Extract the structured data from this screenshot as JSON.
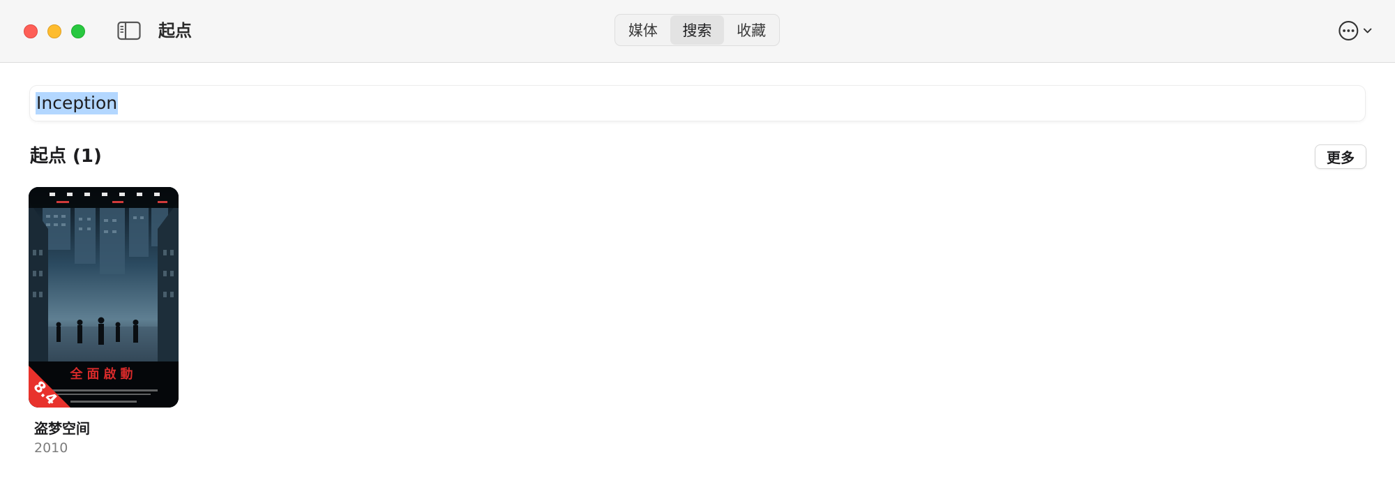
{
  "window": {
    "title": "起点"
  },
  "tabs": [
    {
      "label": "媒体",
      "active": false
    },
    {
      "label": "搜索",
      "active": true
    },
    {
      "label": "收藏",
      "active": false
    }
  ],
  "search": {
    "value": "Inception"
  },
  "section": {
    "title": "起点 (1)",
    "more_label": "更多"
  },
  "results": [
    {
      "title": "盗梦空间",
      "year": "2010",
      "rating": "8.4",
      "poster_title": "全面啟動"
    }
  ],
  "colors": {
    "rating_badge": "#e8322c",
    "selection_highlight": "#b3d7ff",
    "traffic_close": "#fe5f57",
    "traffic_min": "#febc2e",
    "traffic_max": "#28c840"
  },
  "icons": {
    "sidebar_toggle": "sidebar-icon",
    "more_menu": "ellipsis-circle-icon",
    "more_menu_chevron": "chevron-down-icon"
  }
}
